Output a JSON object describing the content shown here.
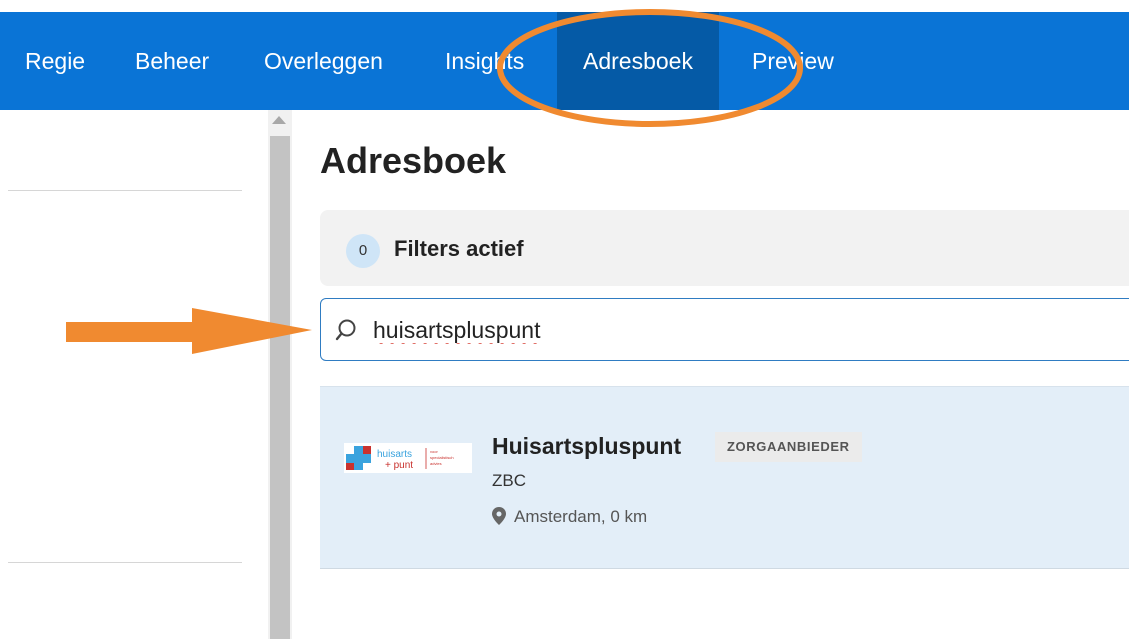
{
  "nav": {
    "items": [
      {
        "label": "Regie"
      },
      {
        "label": "Beheer"
      },
      {
        "label": "Overleggen"
      },
      {
        "label": "Insights"
      },
      {
        "label": "Adresboek",
        "active": true
      },
      {
        "label": "Preview"
      }
    ]
  },
  "main": {
    "title": "Adresboek",
    "filters": {
      "count": "0",
      "label": "Filters actief"
    },
    "search": {
      "value": "huisartspluspunt"
    },
    "results": [
      {
        "name": "Huisartspluspunt",
        "badge": "ZORGAANBIEDER",
        "type": "ZBC",
        "location": "Amsterdam, 0 km",
        "logo": {
          "line1": "huisarts",
          "line2": "+ punt",
          "line3": "voor",
          "line4": "specialistisch",
          "line5": "advies"
        }
      }
    ]
  },
  "colors": {
    "nav_bg": "#0a74d6",
    "nav_active_bg": "#055aa6",
    "annotation_orange": "#f08a30",
    "result_bg": "#e3eef8"
  },
  "icons": [
    "search-icon",
    "location-pin-icon",
    "scroll-up-icon"
  ]
}
